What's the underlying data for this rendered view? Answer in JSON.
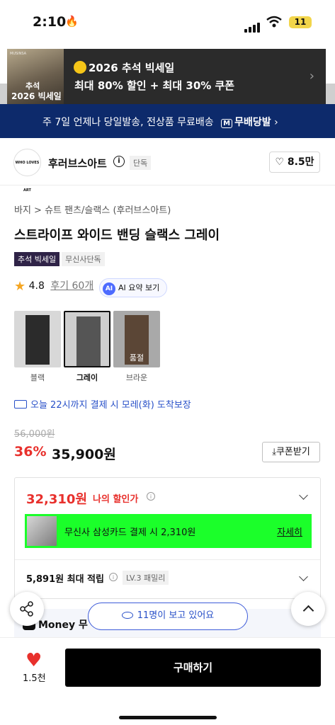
{
  "status": {
    "time": "2:10",
    "battery": "11"
  },
  "banner": {
    "thumb_small": "MUSINSA",
    "thumb_line1": "추석",
    "thumb_line2": "2026 빅세일",
    "title": "2026 추석 빅세일",
    "subtitle": "최대 80% 할인 + 최대 30% 쿠폰"
  },
  "shipping": {
    "text": "주 7일 언제나 당일발송, 전상품 무료배송",
    "badge_text": "무배당발"
  },
  "brand": {
    "logo_text": "WHO LOVES ART",
    "name": "후러브스아트",
    "tag": "단독",
    "likes": "8.5만"
  },
  "breadcrumb": "바지 > 슈트 팬츠/슬랙스 (후러브스아트)",
  "product": {
    "title": "스트라이프 와이드 밴딩 슬랙스 그레이",
    "tags": [
      "추석 빅세일",
      "무신사단독"
    ],
    "rating": "4.8",
    "reviews": "후기 60개",
    "ai_summary": "AI 요약 보기"
  },
  "colors": [
    {
      "label": "블랙",
      "color": "#2b2b2b",
      "selected": false,
      "sold_out": ""
    },
    {
      "label": "그레이",
      "color": "#5a5a5a",
      "selected": true,
      "sold_out": ""
    },
    {
      "label": "브라운",
      "color": "#5b4636",
      "selected": false,
      "sold_out": "품절"
    }
  ],
  "delivery": "오늘 22시까지 결제 시 모레(화) 도착보장",
  "price": {
    "original": "56,000원",
    "discount": "36%",
    "current": "35,900원",
    "coupon_button": "쿠폰받기",
    "my_price": "32,310원",
    "my_label": "나의 할인가",
    "card_text": "무신사 삼성카드 결제 시 2,310원",
    "card_more": "자세히",
    "points": "5,891원 최대 적립",
    "level": "LV.3 패밀리"
  },
  "money": {
    "text": "Money 무"
  },
  "viewers": "11명이 보고 있어요",
  "bottom": {
    "like_count": "1.5천",
    "buy_button": "구매하기"
  }
}
